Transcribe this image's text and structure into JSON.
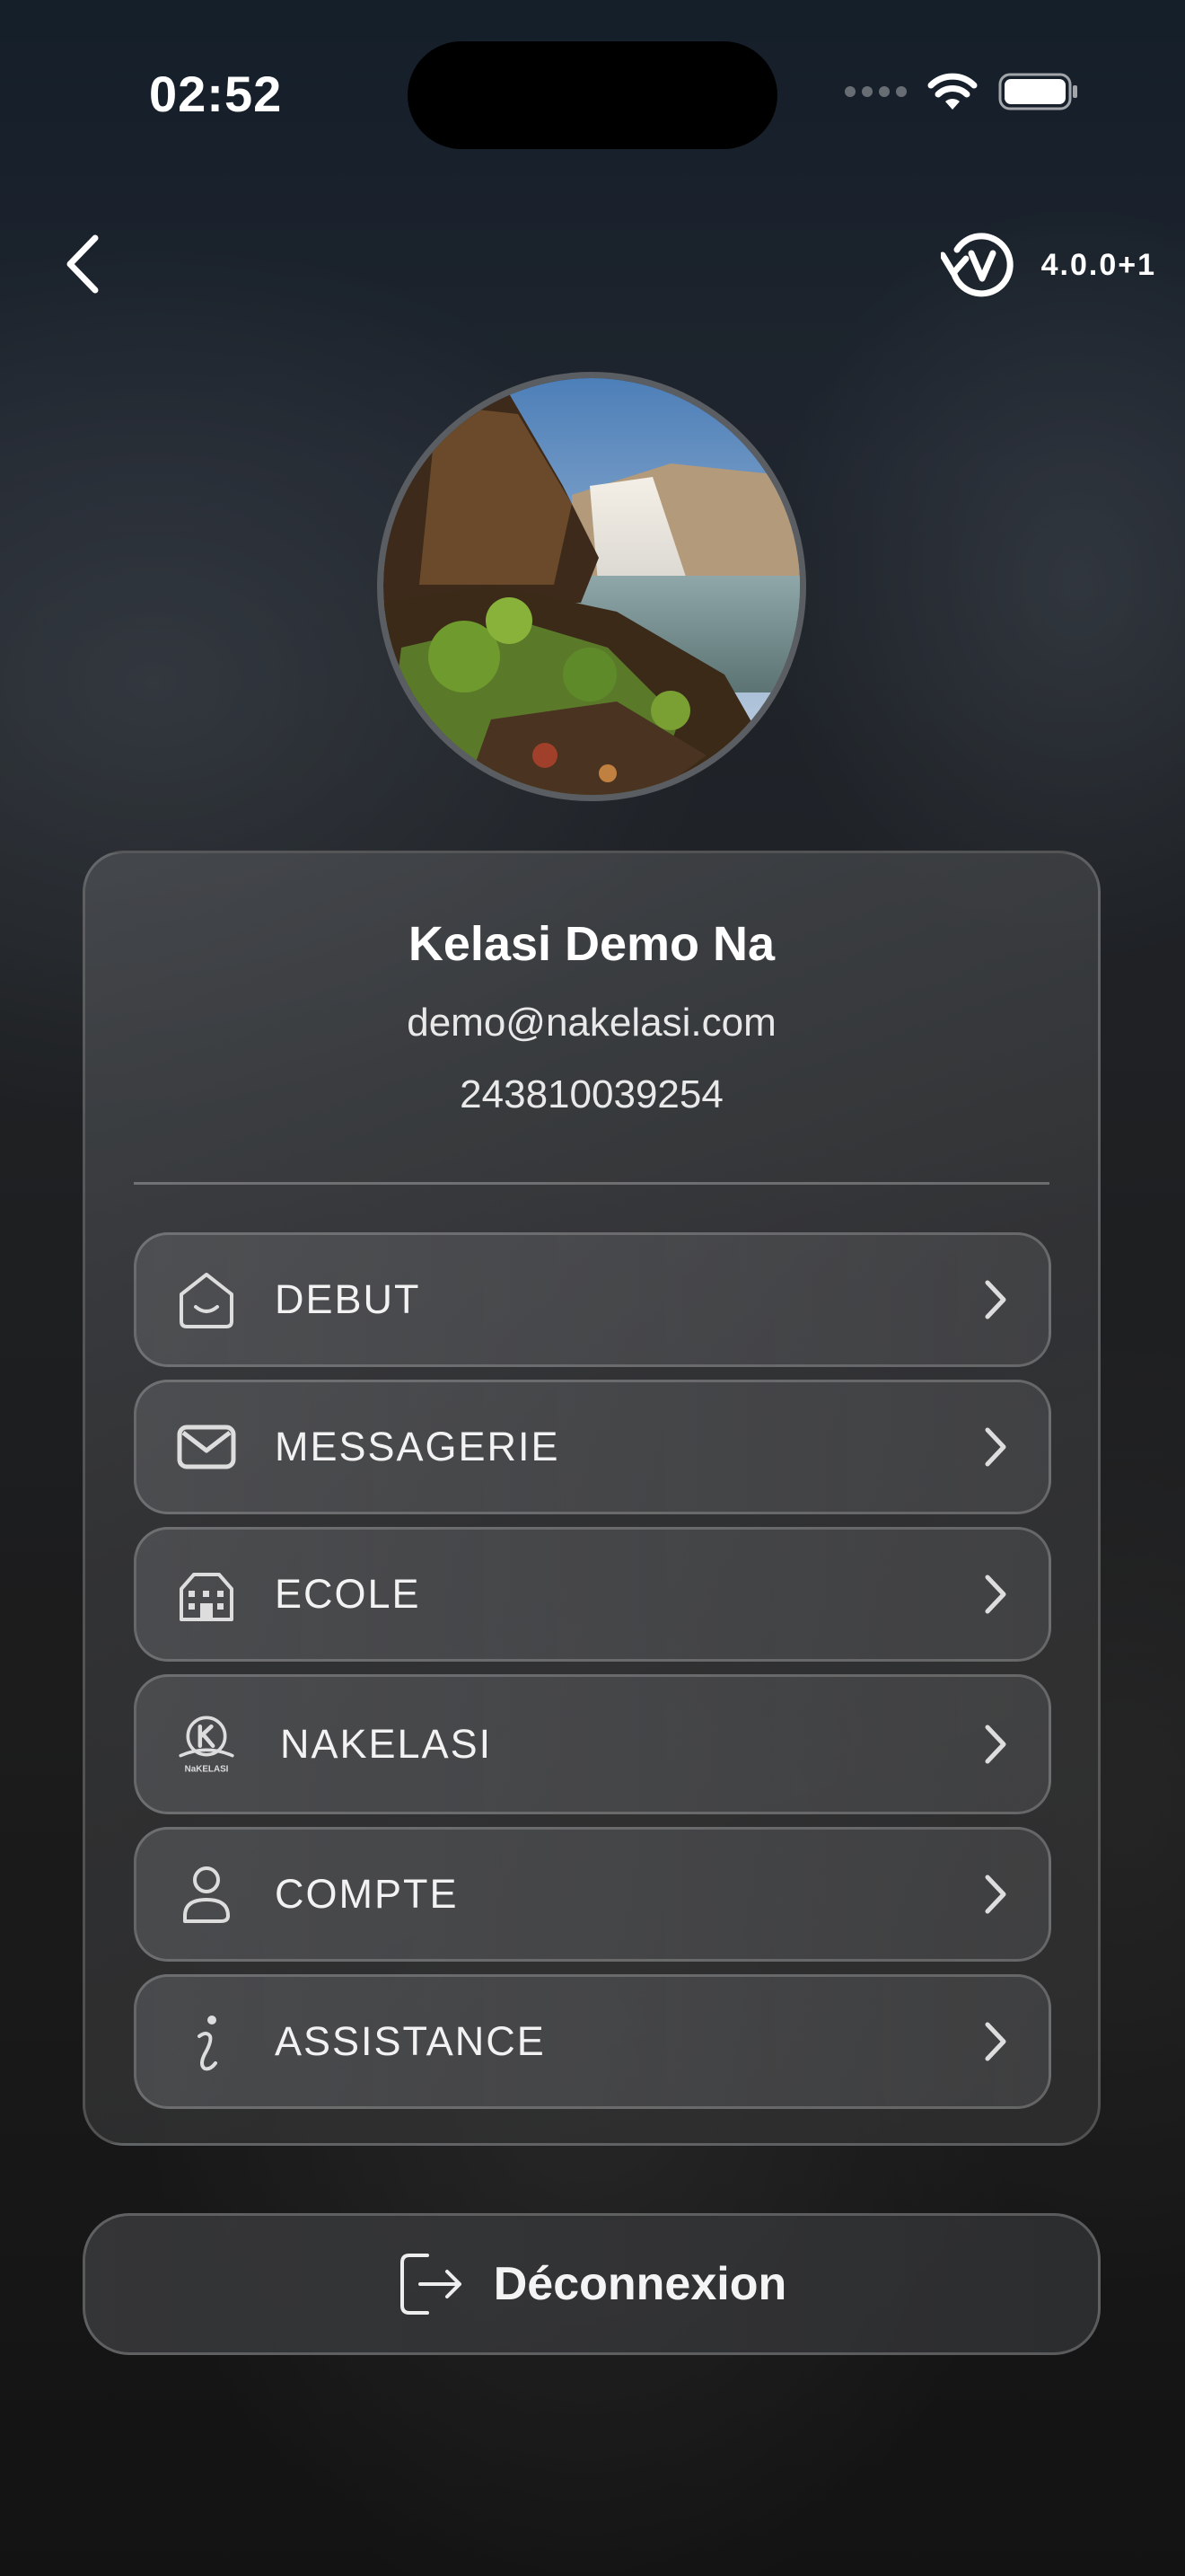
{
  "status_bar": {
    "time": "02:52"
  },
  "header": {
    "version": "4.0.0+1"
  },
  "profile": {
    "name": "Kelasi Demo Na",
    "email": "demo@nakelasi.com",
    "phone": "243810039254"
  },
  "menu": {
    "items": [
      {
        "label": "DEBUT",
        "icon": "home-icon"
      },
      {
        "label": "MESSAGERIE",
        "icon": "mail-icon"
      },
      {
        "label": "ECOLE",
        "icon": "school-icon"
      },
      {
        "label": "NAKELASI",
        "icon": "nakelasi-logo-icon",
        "logo_text": "NaKELASI"
      },
      {
        "label": "COMPTE",
        "icon": "user-icon"
      },
      {
        "label": "ASSISTANCE",
        "icon": "info-icon"
      }
    ]
  },
  "logout": {
    "label": "Déconnexion"
  },
  "colors": {
    "text": "#ffffff",
    "card_border": "#5a5d62",
    "background": "#1f2226"
  }
}
